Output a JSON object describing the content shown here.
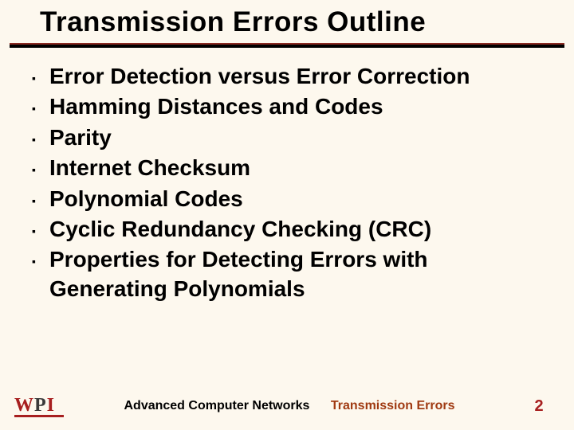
{
  "title": "Transmission Errors Outline",
  "bullets": [
    "Error Detection versus Error Correction",
    "Hamming Distances and Codes",
    "Parity",
    "Internet Checksum",
    "Polynomial Codes",
    "Cyclic Redundancy Checking (CRC)",
    "Properties for Detecting Errors with Generating Polynomials"
  ],
  "footer": {
    "logo": {
      "w": "W",
      "p": "P",
      "i": "I"
    },
    "course": "Advanced Computer Networks",
    "topic": "Transmission Errors",
    "page": "2"
  }
}
